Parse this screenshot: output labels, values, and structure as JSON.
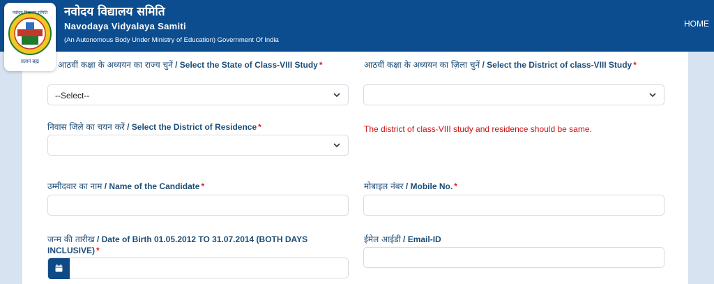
{
  "header": {
    "title_hindi": "नवोदय विद्यालय समिति",
    "title_english": "Navodaya Vidyalaya Samiti",
    "subtitle": "(An Autonomous Body Under Ministry of Education) Government Of India",
    "nav_home": "HOME",
    "logo_text_top": "नवोदय विद्यालय समिति",
    "logo_text_bottom": "प्रज्ञानं ब्रह्म"
  },
  "form": {
    "state_label_hi": "आठवीं कक्षा के अध्ययन का राज्य चुनें",
    "state_label_en": " / Select the State of Class-VIII Study",
    "state_value": "--Select--",
    "district_study_label_hi": "आठवीं कक्षा के अध्ययन का ज़िला चुनें",
    "district_study_label_en": " / Select the District of class-VIII Study",
    "district_study_value": "",
    "residence_label_hi": "निवास जिले का चयन करें",
    "residence_label_en": " / Select the District of Residence",
    "residence_value": "",
    "residence_note": "The district of class-VIII study and residence should be same.",
    "name_label_hi": "उम्मीदवार का नाम",
    "name_label_en": " / Name of the Candidate",
    "name_value": "",
    "mobile_label_hi": "मोबाइल नंबर",
    "mobile_label_en": " / Mobile No.",
    "mobile_value": "",
    "dob_label_hi": "जन्म की तारीख",
    "dob_label_en_line1": " / Date of Birth 01.05.2012 TO 31.07.2014 (BOTH DAYS",
    "dob_label_en_line2": "INCLUSIVE)",
    "dob_value": "",
    "email_label_hi": "ईमेल आईडी",
    "email_label_en": " / Email-ID",
    "email_value": "",
    "required_mark": "*"
  },
  "colors": {
    "header_bg": "#0c4d8f",
    "label_text": "#1d4e78",
    "required": "#e02020",
    "note_text": "#cc1111"
  }
}
